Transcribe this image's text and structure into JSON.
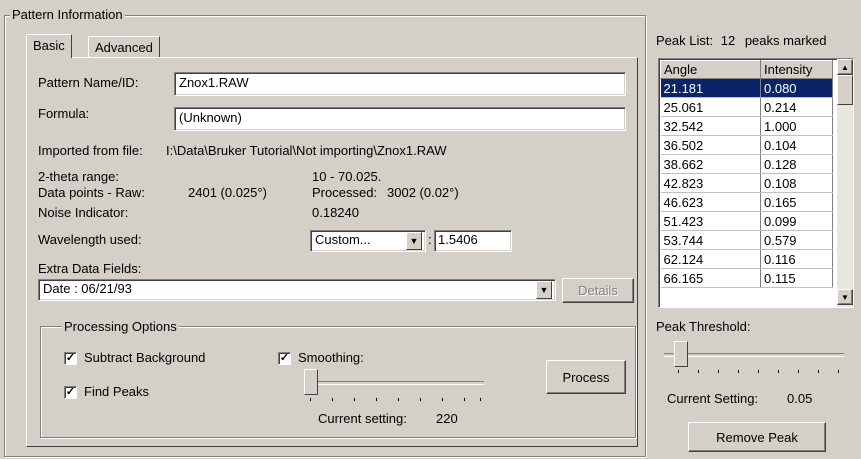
{
  "pattern_group": {
    "title": "Pattern Information",
    "tabs": [
      {
        "label": "Basic",
        "active": true
      },
      {
        "label": "Advanced",
        "active": false
      }
    ],
    "name_label": "Pattern Name/ID:",
    "name_value": "Znox1.RAW",
    "formula_label": "Formula:",
    "formula_value": "(Unknown)",
    "imported_label": "Imported from file:",
    "imported_value": "I:\\Data\\Bruker Tutorial\\Not importing\\Znox1.RAW",
    "two_theta_label": "2-theta range:",
    "two_theta_value": "10  - 70.025.",
    "data_points_label": "Data points - Raw:",
    "data_points_raw": "2401 (0.025°)",
    "processed_label": "Processed:",
    "processed_value": "3002 (0.02°)",
    "noise_label": "Noise Indicator:",
    "noise_value": "0.18240",
    "wavelength_label": "Wavelength used:",
    "wavelength_select": "Custom...",
    "wavelength_sep": ":",
    "wavelength_value": "1.5406",
    "extra_label": "Extra Data Fields:",
    "extra_select": "Date : 06/21/93",
    "details_label": "Details",
    "processing": {
      "title": "Processing Options",
      "subtract_label": "Subtract Background",
      "subtract_checked": true,
      "find_peaks_label": "Find Peaks",
      "find_peaks_checked": true,
      "smoothing_label": "Smoothing:",
      "smoothing_checked": true,
      "smoothing_level": 0.04,
      "current_setting_label": "Current setting:",
      "current_setting_value": "220",
      "process_label": "Process"
    }
  },
  "peak_panel": {
    "peak_list_label": "Peak List:",
    "peak_count": "12",
    "peaks_marked_label": "peaks marked",
    "columns": [
      "Angle",
      "Intensity"
    ],
    "rows": [
      [
        "21.181",
        "0.080"
      ],
      [
        "25.061",
        "0.214"
      ],
      [
        "32.542",
        "1.000"
      ],
      [
        "36.502",
        "0.104"
      ],
      [
        "38.662",
        "0.128"
      ],
      [
        "42.823",
        "0.108"
      ],
      [
        "46.623",
        "0.165"
      ],
      [
        "51.423",
        "0.099"
      ],
      [
        "53.744",
        "0.579"
      ],
      [
        "62.124",
        "0.116"
      ],
      [
        "66.165",
        "0.115"
      ]
    ],
    "selected_row": 0,
    "threshold_label": "Peak Threshold:",
    "threshold_level": 0.05,
    "current_label": "Current Setting:",
    "current_value": "0.05",
    "remove_label": "Remove Peak"
  }
}
